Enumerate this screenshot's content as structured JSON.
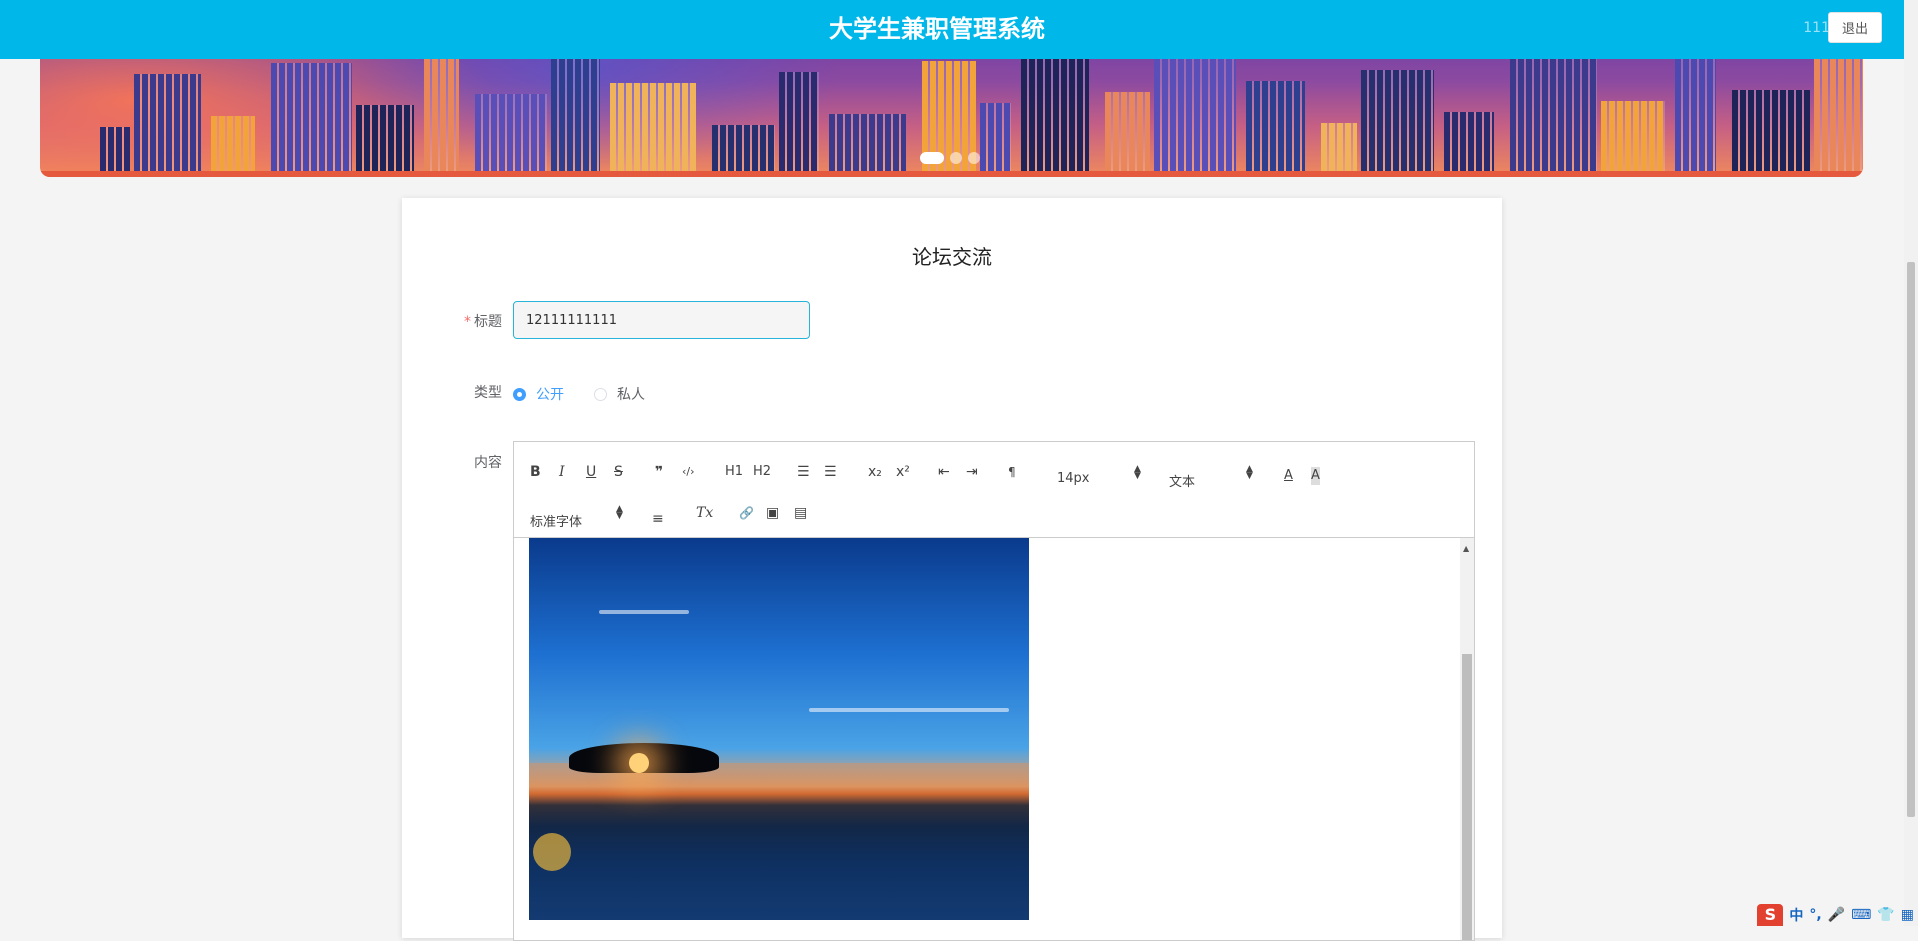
{
  "header": {
    "title": "大学生兼职管理系统",
    "user": "111",
    "logout_label": "退出"
  },
  "banner": {
    "slides": 3,
    "active_slide": 1
  },
  "form": {
    "page_title": "论坛交流",
    "title_label": "标题",
    "title_required_mark": "*",
    "title_value": "12111111111",
    "type_label": "类型",
    "type_options": [
      "公开",
      "私人"
    ],
    "type_selected": "公开",
    "content_label": "内容"
  },
  "editor": {
    "toolbar": {
      "bold": "B",
      "italic": "I",
      "underline": "U",
      "strike": "S",
      "blockquote": "❞",
      "code": "‹/›",
      "h1": "H1",
      "h2": "H2",
      "ordered_list": "☰",
      "bullet_list": "☰",
      "subscript": "x₂",
      "superscript": "x²",
      "outdent": "⇤",
      "indent": "⇥",
      "direction": "¶",
      "size": "14px",
      "header": "文本",
      "color": "A",
      "background": "A",
      "font": "标准字体",
      "align": "≡",
      "clean": "Tx",
      "link": "🔗",
      "image": "▣",
      "video": "▤"
    }
  },
  "ime": {
    "logo": "S",
    "items": [
      "中",
      "°,",
      "🎤",
      "⌨",
      "👕",
      "▦"
    ]
  },
  "colors": {
    "header": "#00b7ea",
    "accent": "#409eff",
    "required": "#f56c6c"
  }
}
